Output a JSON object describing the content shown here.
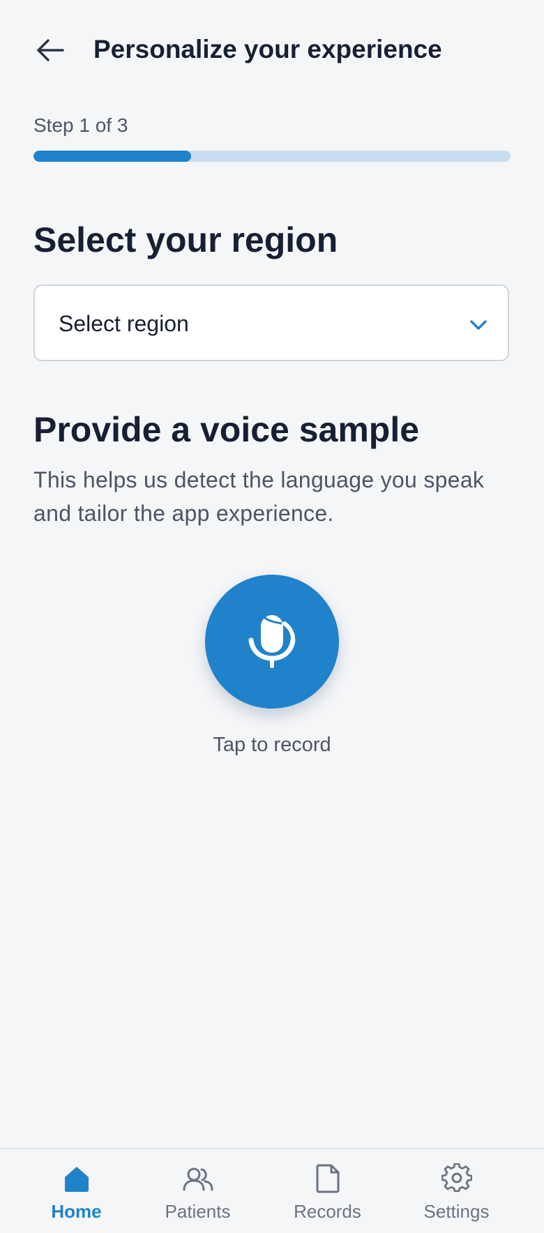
{
  "header": {
    "title": "Personalize your experience",
    "back_icon": "arrow-left-icon"
  },
  "progress": {
    "step_label": "Step 1 of 3",
    "fraction": 0.33
  },
  "region": {
    "heading": "Select your region",
    "placeholder": "Select region",
    "icon": "chevron-down-icon"
  },
  "voice": {
    "heading": "Provide a voice sample",
    "description": "This helps us detect the language you speak and tailor the app experience.",
    "record_icon": "microphone-icon",
    "tap_label": "Tap to record"
  },
  "nav": {
    "items": [
      {
        "label": "Home",
        "icon": "home-icon",
        "active": true
      },
      {
        "label": "Patients",
        "icon": "users-icon",
        "active": false
      },
      {
        "label": "Records",
        "icon": "document-icon",
        "active": false
      },
      {
        "label": "Settings",
        "icon": "gear-icon",
        "active": false
      }
    ]
  },
  "colors": {
    "accent": "#1f82cb",
    "track": "#c8ddef",
    "background": "#f5f6f8",
    "text_primary": "#172033",
    "text_secondary": "#4b5565"
  }
}
